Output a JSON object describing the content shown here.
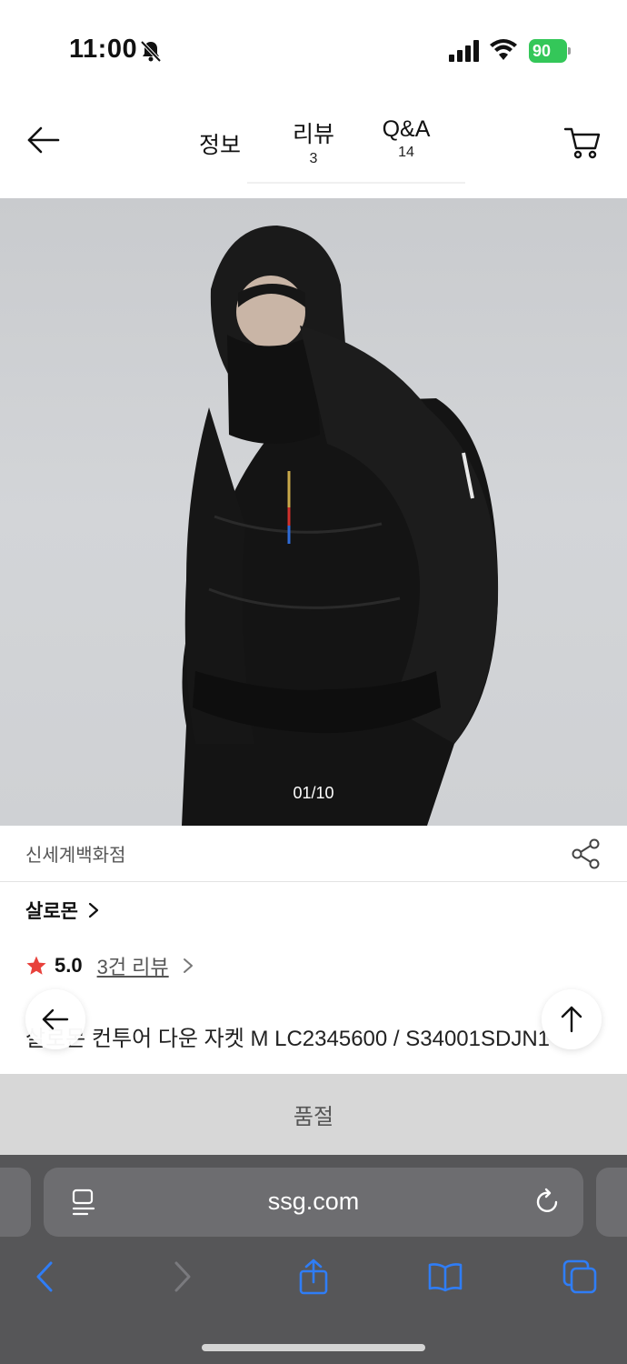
{
  "status": {
    "time": "11:00",
    "battery": "90"
  },
  "header": {
    "tabs": [
      {
        "label": "정보",
        "count": ""
      },
      {
        "label": "리뷰",
        "count": "3"
      },
      {
        "label": "Q&A",
        "count": "14"
      }
    ],
    "icons": {
      "back": "arrow-left-icon",
      "cart": "cart-icon"
    }
  },
  "product": {
    "image_counter": "01/10",
    "seller": "신세계백화점",
    "brand": "살로몬",
    "rating": "5.0",
    "review_link": "3건 리뷰",
    "title": "살로몬 컨투어 다운 자켓 M LC2345600 / S34001SDJN1",
    "sold_out": "품절"
  },
  "browser": {
    "url": "ssg.com"
  },
  "colors": {
    "star": "#e8413b",
    "browser_bg": "#565658",
    "soldout_bg": "#d7d7d7",
    "toolbar_blue": "#2f7df6"
  }
}
